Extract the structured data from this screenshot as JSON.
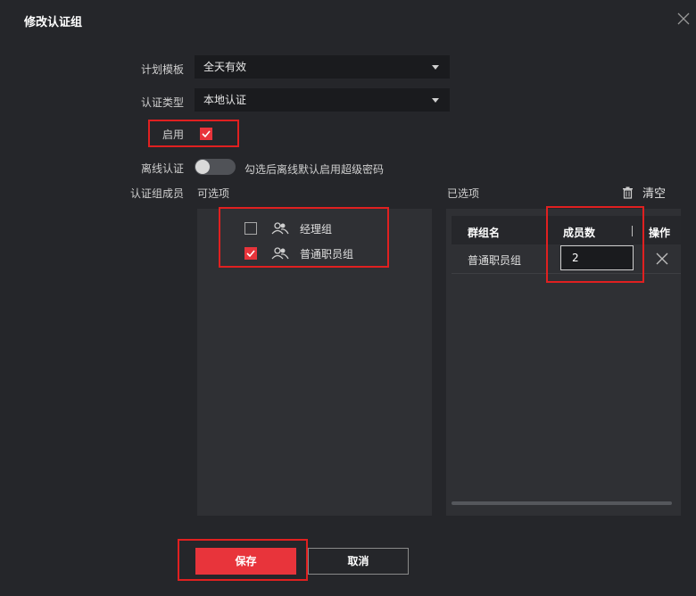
{
  "dialog": {
    "title": "修改认证组"
  },
  "form": {
    "plan_template_label": "计划模板",
    "plan_template_value": "全天有效",
    "auth_type_label": "认证类型",
    "auth_type_value": "本地认证",
    "enable_label": "启用",
    "enable_checked": true,
    "offline_label": "离线认证",
    "offline_enabled": false,
    "offline_hint": "勾选后离线默认启用超级密码",
    "members_label": "认证组成员"
  },
  "available": {
    "header": "可选项",
    "items": [
      {
        "label": "经理组",
        "checked": false
      },
      {
        "label": "普通职员组",
        "checked": true
      }
    ]
  },
  "selected": {
    "header": "已选项",
    "clear_label": "清空",
    "columns": [
      "群组名",
      "成员数",
      "操作"
    ],
    "rows": [
      {
        "group_name": "普通职员组",
        "member_count": "2"
      }
    ]
  },
  "buttons": {
    "save": "保存",
    "cancel": "取消"
  },
  "colors": {
    "accent": "#e8343b",
    "annotation": "#e02020",
    "background": "#25262a"
  }
}
